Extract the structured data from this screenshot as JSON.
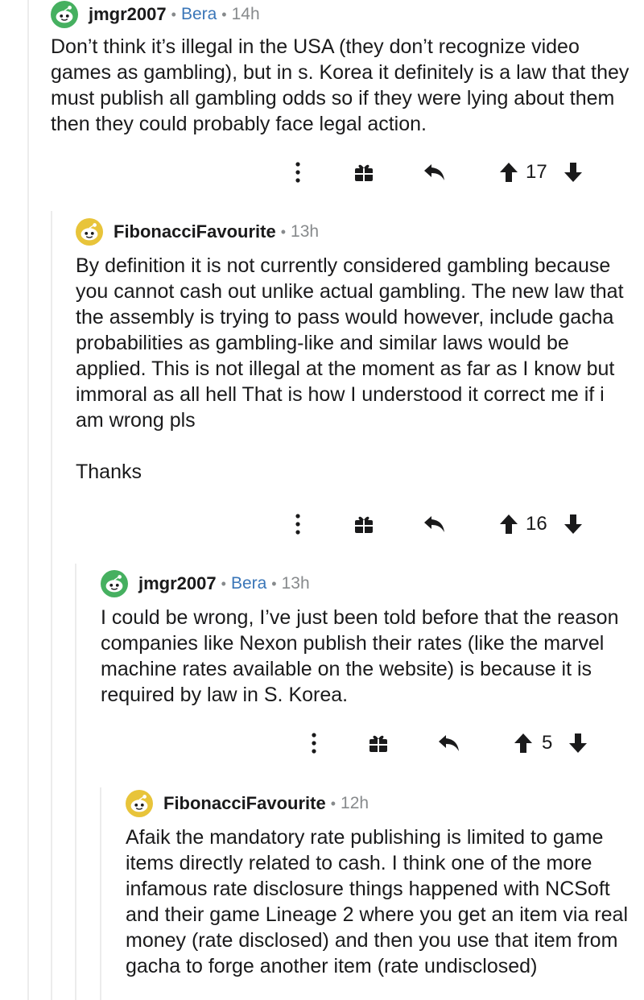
{
  "comments": [
    {
      "username": "jmgr2007",
      "flair": "Bera",
      "time": "14h",
      "paragraphs": [
        "Don’t think it’s illegal in the USA (they don’t recognize video games as gambling), but in s. Korea it definitely is a law that they must publish all gambling odds so if they were lying about them then they could probably face legal action."
      ],
      "score": "17"
    },
    {
      "username": "FibonacciFavourite",
      "time": "13h",
      "paragraphs": [
        "By definition it is not currently considered gambling because you cannot cash out unlike actual gambling. The new law that the assembly is trying to pass would however, include gacha probabilities as gambling-like and similar laws would be applied. This is not illegal at the moment as far as I know but immoral as all hell That is how I understood it correct me if i am wrong pls",
        "Thanks"
      ],
      "score": "16"
    },
    {
      "username": "jmgr2007",
      "flair": "Bera",
      "time": "13h",
      "paragraphs": [
        "I could be wrong, I’ve just been told before that the reason companies like Nexon publish their rates (like the marvel machine rates available on the website) is because it is required by law in S. Korea."
      ],
      "score": "5"
    },
    {
      "username": "FibonacciFavourite",
      "time": "12h",
      "paragraphs": [
        "Afaik the mandatory rate publishing is limited to game items directly related to cash. I think one of the more infamous rate disclosure things happened with NCSoft and their game Lineage 2 where you get an item via real money (rate disclosed) and then you use that item from gacha to forge another item (rate undisclosed)"
      ]
    }
  ],
  "separator": "•",
  "icons": {
    "more": "more-vertical-icon",
    "award": "award-gift-icon",
    "reply": "reply-arrow-icon",
    "upvote": "upvote-arrow-icon",
    "downvote": "downvote-arrow-icon",
    "avatar_green": "#46b060",
    "avatar_yellow": "#e8c43a"
  }
}
